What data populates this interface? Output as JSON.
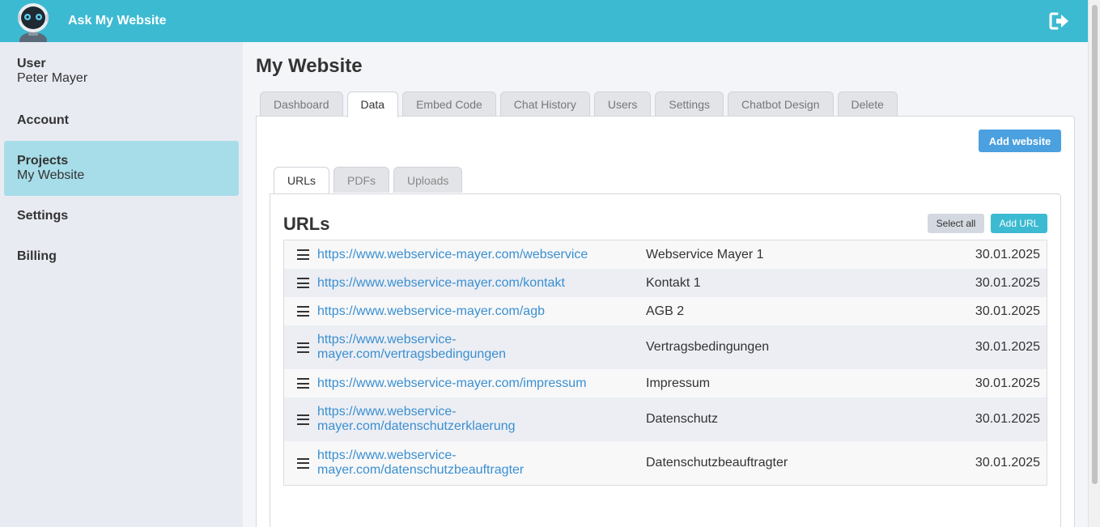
{
  "header": {
    "app_title": "Ask My Website",
    "avatar_icon": "robot-icon",
    "logout_icon": "logout-icon",
    "brand_color": "#3cbad1"
  },
  "sidebar": {
    "items": [
      {
        "label": "User",
        "sub": "Peter Mayer"
      },
      {
        "label": "Account",
        "sub": ""
      },
      {
        "label": "Projects",
        "sub": "My Website"
      },
      {
        "label": "Settings",
        "sub": ""
      },
      {
        "label": "Billing",
        "sub": ""
      }
    ],
    "active_index": 2
  },
  "main": {
    "page_title": "My Website",
    "tabs": [
      "Dashboard",
      "Data",
      "Embed Code",
      "Chat History",
      "Users",
      "Settings",
      "Chatbot Design",
      "Delete"
    ],
    "active_tab": "Data",
    "add_website_label": "Add website",
    "subtabs": [
      "URLs",
      "PDFs",
      "Uploads"
    ],
    "active_subtab": "URLs",
    "section_title": "URLs",
    "select_all_label": "Select all",
    "add_url_label": "Add URL",
    "urls": [
      {
        "url": "https://www.webservice-mayer.com/webservice",
        "name": "Webservice Mayer 1",
        "date": "30.01.2025"
      },
      {
        "url": "https://www.webservice-mayer.com/kontakt",
        "name": "Kontakt 1",
        "date": "30.01.2025"
      },
      {
        "url": "https://www.webservice-mayer.com/agb",
        "name": "AGB 2",
        "date": "30.01.2025"
      },
      {
        "url_line1": "https://www.webservice-",
        "url_line2": "mayer.com/vertragsbedingungen",
        "name": "Vertragsbedingungen",
        "date": "30.01.2025"
      },
      {
        "url": "https://www.webservice-mayer.com/impressum",
        "name": "Impressum",
        "date": "30.01.2025"
      },
      {
        "url_line1": "https://www.webservice-",
        "url_line2": "mayer.com/datenschutzerklaerung",
        "name": "Datenschutz",
        "date": "30.01.2025"
      },
      {
        "url_line1": "https://www.webservice-",
        "url_line2": "mayer.com/datenschutzbeauftragter",
        "name": "Datenschutzbeauftragter",
        "date": "30.01.2025"
      }
    ]
  }
}
